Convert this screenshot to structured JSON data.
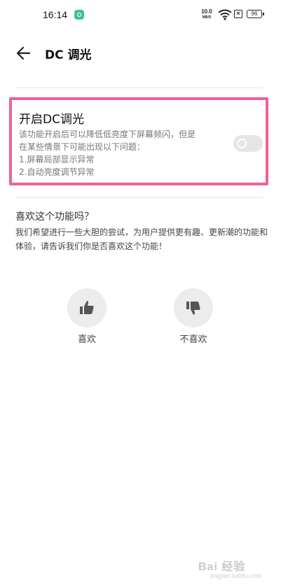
{
  "status_bar": {
    "time": "16:14",
    "net_speed_value": "10.0",
    "net_speed_unit": "MB/S",
    "sim_icon": "×",
    "battery": "96",
    "icons": [
      "app-notification-icon",
      "wifi-icon",
      "sim-icon",
      "battery-icon"
    ]
  },
  "header": {
    "back_icon": "arrow-left-icon",
    "title": "DC 调光"
  },
  "dc_setting": {
    "title": "开启DC调光",
    "description": "该功能开启后可以降低低亮度下屏幕频闪，但是\n在某些情景下可能出现以下问题：\n1.屏幕局部显示异常\n2.自动亮度调节异常",
    "toggle_on": false,
    "highlight_color": "#f0609a"
  },
  "feedback": {
    "title": "喜欢这个功能吗？",
    "description": "我们希望进行一些大胆的尝试，为用户提供更有趣、更新潮的功能和体验，请告诉我们你是否喜欢这个功能！",
    "like_label": "喜欢",
    "dislike_label": "不喜欢",
    "like_icon": "thumbs-up-icon",
    "dislike_icon": "thumbs-down-icon"
  },
  "watermark": {
    "text": "Bai 经验",
    "sub": "jingyan.baidu.com"
  }
}
